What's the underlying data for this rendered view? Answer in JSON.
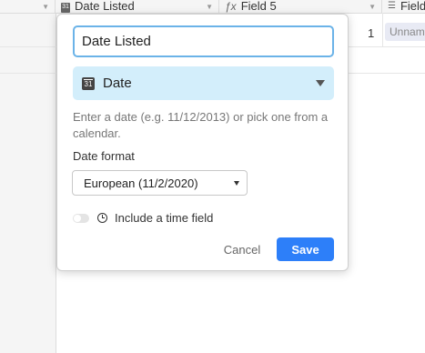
{
  "grid": {
    "columns": [
      {
        "icon": "calendar-icon",
        "label": "Date Listed"
      },
      {
        "icon": "formula-icon",
        "label": "Field 5"
      },
      {
        "icon": "list-icon",
        "label": "Field"
      }
    ],
    "row": {
      "number_value": "1",
      "chip_text": "Unnam"
    }
  },
  "popup": {
    "field_name": "Date Listed",
    "field_type": {
      "icon": "calendar-icon",
      "label": "Date"
    },
    "help_text": "Enter a date (e.g. 11/12/2013) or pick one from a calendar.",
    "date_format_label": "Date format",
    "date_format_value": "European (11/2/2020)",
    "include_time_label": "Include a time field",
    "include_time_enabled": false,
    "cancel_label": "Cancel",
    "save_label": "Save",
    "colors": {
      "save_button": "#2d7ff9",
      "type_select_bg": "#d3eefb",
      "input_focus_border": "#6bb3e8"
    }
  }
}
